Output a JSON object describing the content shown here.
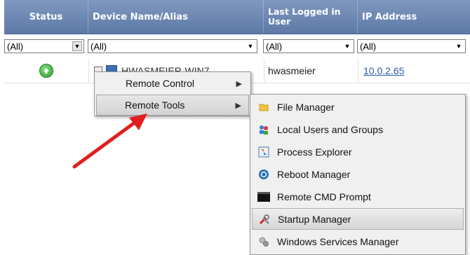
{
  "columns": {
    "status": "Status",
    "device": "Device Name/Alias",
    "last_user": "Last Logged in User",
    "ip": "IP Address"
  },
  "filters": {
    "status": "(All)",
    "device": "(All)",
    "last_user": "(All)",
    "ip": "(All)"
  },
  "row": {
    "device_name": "HWASMEIER-WIN7",
    "user": "hwasmeier",
    "ip": "10.0.2.65"
  },
  "context_menu": {
    "items": [
      "Remote Control",
      "Remote Tools"
    ]
  },
  "remote_tools": {
    "items": [
      {
        "label": "File Manager",
        "icon": "folder-icon"
      },
      {
        "label": "Local Users and Groups",
        "icon": "users-icon"
      },
      {
        "label": "Process Explorer",
        "icon": "process-icon"
      },
      {
        "label": "Reboot Manager",
        "icon": "reboot-icon"
      },
      {
        "label": "Remote CMD Prompt",
        "icon": "cmd-icon"
      },
      {
        "label": "Startup Manager",
        "icon": "tools-icon"
      },
      {
        "label": "Windows Services Manager",
        "icon": "services-icon"
      }
    ]
  },
  "colors": {
    "header": "#6b86b2",
    "highlight": "#d6d6d6",
    "arrow": "#e02020"
  }
}
